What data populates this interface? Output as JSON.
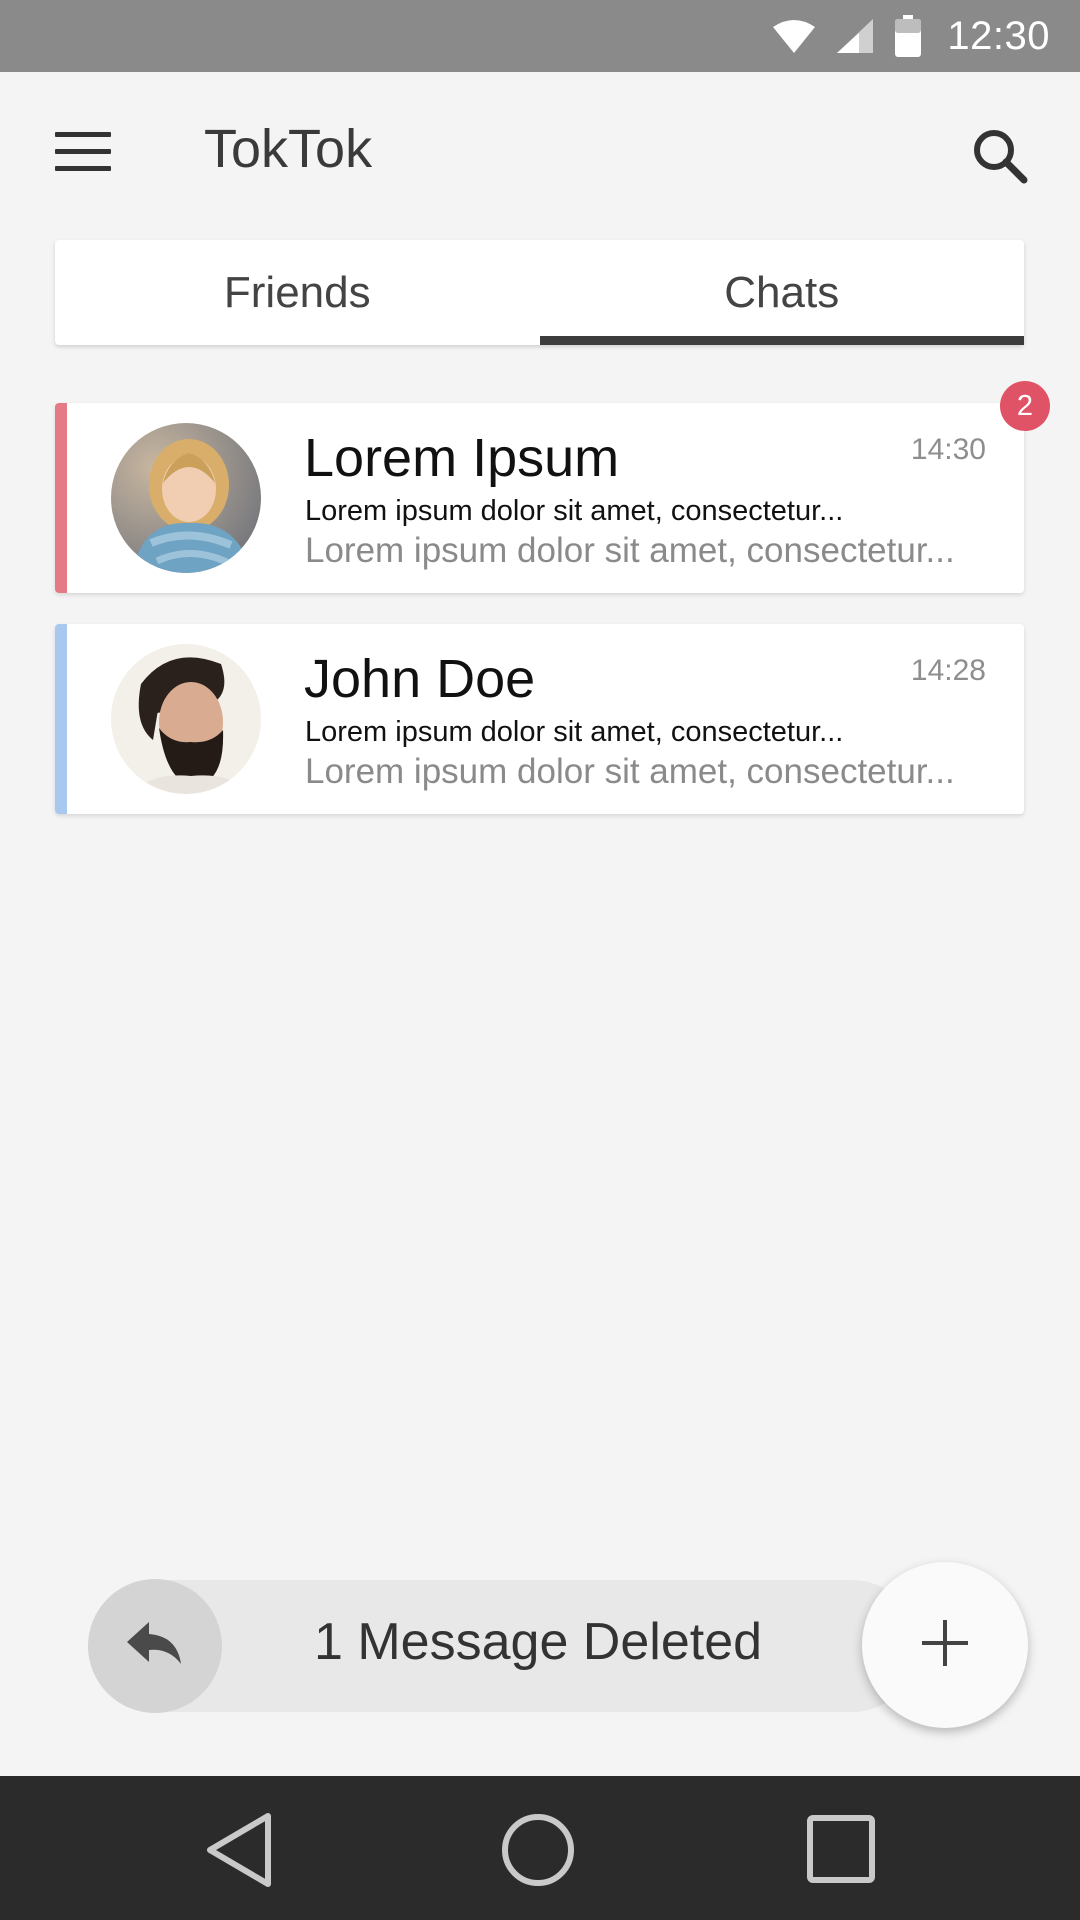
{
  "status_bar": {
    "time": "12:30",
    "icons": [
      "wifi-icon",
      "signal-icon",
      "battery-icon"
    ]
  },
  "app_bar": {
    "title": "TokTok",
    "menu_icon": "menu-icon",
    "search_icon": "search-icon"
  },
  "tabs": [
    {
      "label": "Friends",
      "active": false
    },
    {
      "label": "Chats",
      "active": true
    }
  ],
  "chats": [
    {
      "name": "Lorem Ipsum",
      "time": "14:30",
      "line1": "Lorem ipsum dolor sit amet, consectetur...",
      "line2": "Lorem ipsum dolor sit amet, consectetur...",
      "accent_color": "#e57a87",
      "unread": "2"
    },
    {
      "name": "John Doe",
      "time": "14:28",
      "line1": "Lorem ipsum dolor sit amet, consectetur...",
      "line2": "Lorem ipsum dolor sit amet, consectetur...",
      "accent_color": "#a8c8ef"
    }
  ],
  "snackbar": {
    "message": "1 Message Deleted",
    "undo_icon": "reply-icon"
  },
  "fab": {
    "icon": "plus-icon"
  },
  "nav_bar": {
    "icons": [
      "back-icon",
      "home-icon",
      "recents-icon"
    ]
  },
  "colors": {
    "badge": "#e05266",
    "status_bar": "#8a8a8a",
    "nav_bar": "#2b2b2b",
    "tab_indicator": "#3c3c3c"
  }
}
